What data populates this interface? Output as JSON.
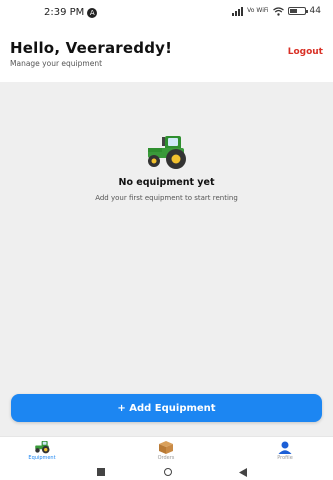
{
  "status_bar": {
    "time": "2:39 PM",
    "notification_glyph": "A",
    "network_label": "Vo WiFi",
    "battery_text": "44"
  },
  "header": {
    "greeting": "Hello, Veerareddy!",
    "subtitle": "Manage your equipment",
    "logout_label": "Logout"
  },
  "empty_state": {
    "icon": "tractor-icon",
    "title": "No equipment yet",
    "message": "Add your first equipment to start renting"
  },
  "add_button_label": "+ Add Equipment",
  "bottom_nav": {
    "items": [
      {
        "label": "Equipment",
        "icon": "tractor-icon",
        "active": true
      },
      {
        "label": "Orders",
        "icon": "package-icon",
        "active": false
      },
      {
        "label": "Profile",
        "icon": "user-icon",
        "active": false
      }
    ]
  },
  "colors": {
    "accent": "#1c86f2",
    "logout": "#d93025",
    "background": "#efefef",
    "tractor_green": "#3a9a3a"
  }
}
